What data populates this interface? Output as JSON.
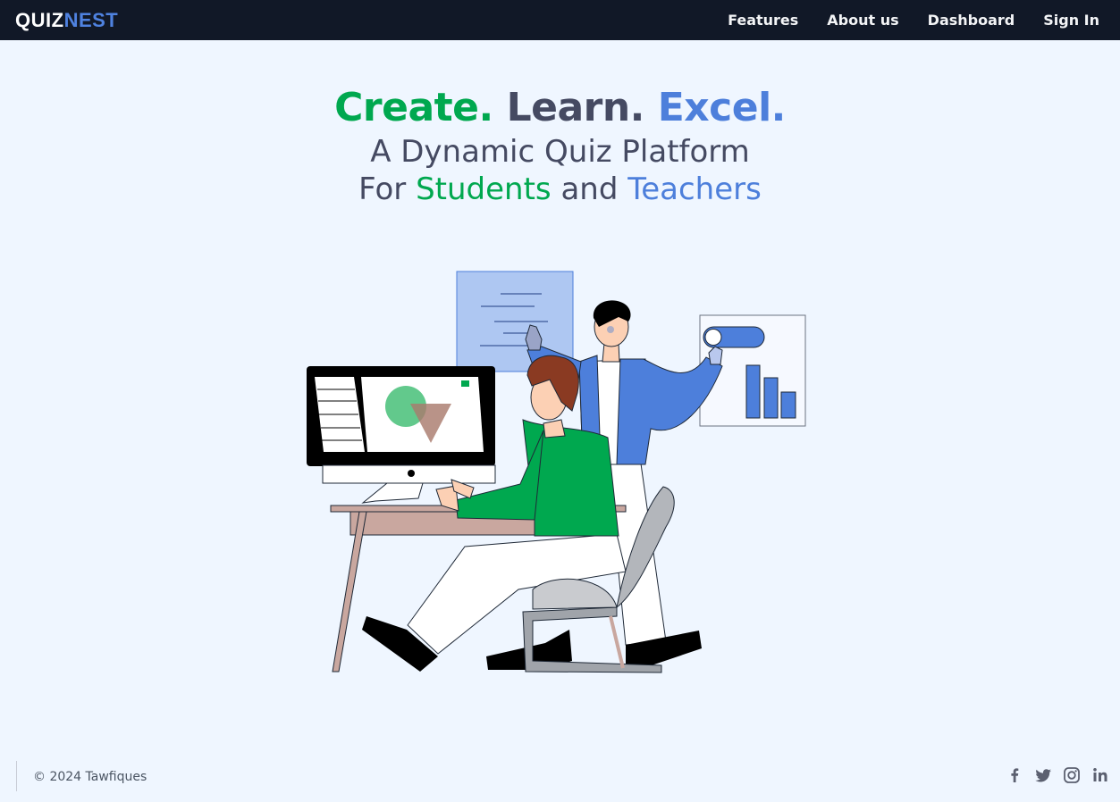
{
  "navbar": {
    "brand_part1": "QUIZ",
    "brand_part2": "NEST",
    "links": [
      "Features",
      "About us",
      "Dashboard",
      "Sign In"
    ]
  },
  "hero": {
    "headline": [
      "Create.",
      "Learn.",
      "Excel."
    ],
    "subtitle_line1": "A Dynamic Quiz Platform",
    "subtitle_for": "For",
    "subtitle_students": "Students",
    "subtitle_and": "and",
    "subtitle_teachers": "Teachers"
  },
  "illustration": {
    "icon": "students-teacher-computer-illustration"
  },
  "footer": {
    "copyright": "© 2024 Tawfiques",
    "social_icons": [
      "facebook-icon",
      "twitter-icon",
      "instagram-icon",
      "linkedin-icon"
    ]
  },
  "colors": {
    "navbar_bg": "#111827",
    "page_bg": "#eff6ff",
    "accent_green": "#00a84f",
    "accent_blue": "#4d7fdb",
    "text_slate": "#454a62"
  }
}
